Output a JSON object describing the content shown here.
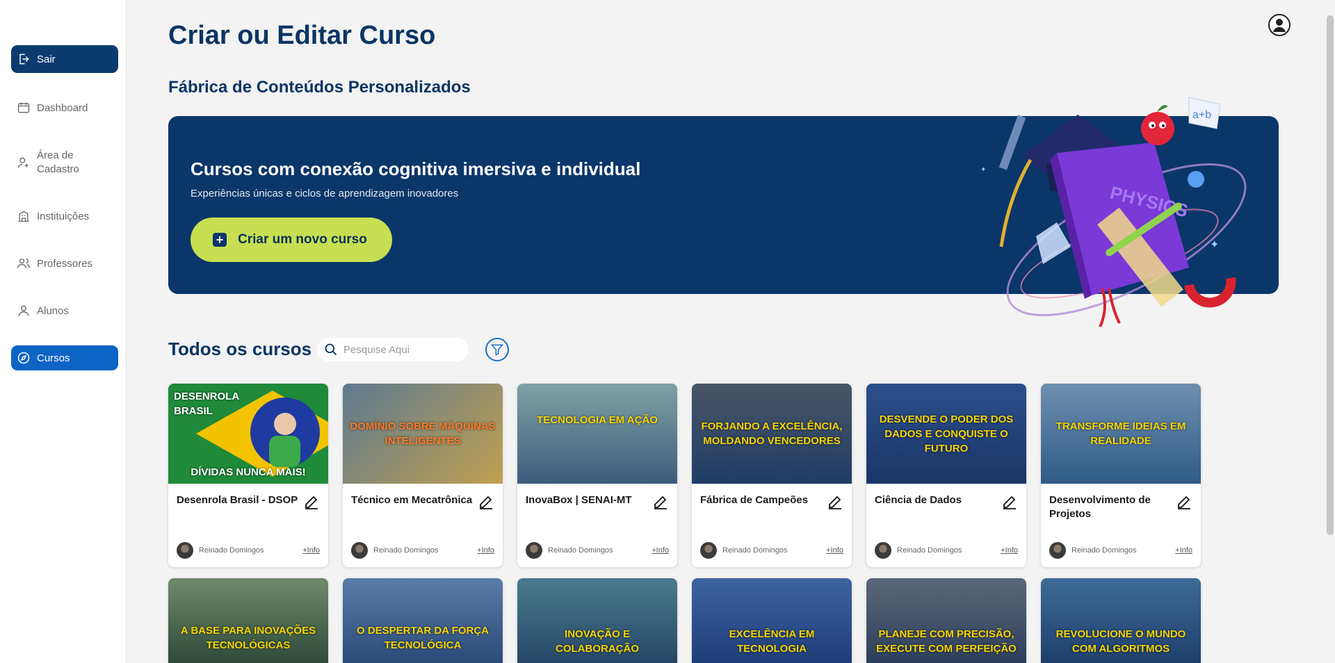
{
  "sidebar": {
    "items": [
      {
        "label": "Sair",
        "icon": "logout-icon"
      },
      {
        "label": "Dashboard",
        "icon": "calendar-icon"
      },
      {
        "label": "Área de Cadastro",
        "icon": "user-add-icon"
      },
      {
        "label": "Instituições",
        "icon": "building-icon"
      },
      {
        "label": "Professores",
        "icon": "users-icon"
      },
      {
        "label": "Alunos",
        "icon": "user-icon"
      },
      {
        "label": "Cursos",
        "icon": "compass-icon"
      }
    ]
  },
  "header": {
    "title": "Criar ou Editar Curso",
    "subtitle": "Fábrica de Conteúdos Personalizados",
    "profile_icon": "profile-icon"
  },
  "banner": {
    "title": "Cursos com conexão cognitiva imersiva e individual",
    "subtitle": "Experiências únicas e ciclos de aprendizagem inovadores",
    "cta_label": "Criar um novo curso",
    "book_word": "PHYSICS",
    "note_text": "a+b"
  },
  "courses_section": {
    "title": "Todos os cursos",
    "search_placeholder": "Pesquise Aqui",
    "filter_icon": "filter-icon"
  },
  "courses": [
    {
      "thumb_lines": [
        "DESENROLA",
        "BRASIL",
        "DÍVIDAS NUNCA MAIS!"
      ],
      "title": "Desenrola Brasil - DSOP",
      "author": "Reinado Domingos",
      "info": "+Info",
      "color": "#1f8a3a"
    },
    {
      "thumb_lines": [
        "DOMÍNIO SOBRE MÁQUINAS INTELIGENTES"
      ],
      "title": "Técnico em Mecatrônica",
      "author": "Reinado Domingos",
      "info": "+Info",
      "color": "#3f6e8c"
    },
    {
      "thumb_lines": [
        "TECNOLOGIA EM AÇÃO"
      ],
      "title": "InovaBox | SENAI-MT",
      "author": "Reinado Domingos",
      "info": "+Info",
      "color": "#4c6d8f"
    },
    {
      "thumb_lines": [
        "FORJANDO A EXCELÊNCIA, MOLDANDO VENCEDORES"
      ],
      "title": "Fábrica de Campeões",
      "author": "Reinado Domingos",
      "info": "+Info",
      "color": "#2f4e6e"
    },
    {
      "thumb_lines": [
        "DESVENDE O PODER DOS DADOS E CONQUISTE O FUTURO"
      ],
      "title": "Ciência de Dados",
      "author": "Reinado Domingos",
      "info": "+Info",
      "color": "#284d83"
    },
    {
      "thumb_lines": [
        "TRANSFORME IDEIAS EM REALIDADE"
      ],
      "title": "Desenvolvimento de Projetos",
      "author": "Reinado Domingos",
      "info": "+Info",
      "color": "#3b6a93"
    }
  ],
  "courses_row2": [
    {
      "thumb_lines": [
        "A BASE PARA INOVAÇÕES TECNOLÓGICAS"
      ],
      "color": "#466a4a"
    },
    {
      "thumb_lines": [
        "O DESPERTAR DA FORÇA TECNOLÓGICA"
      ],
      "color": "#3b5f86"
    },
    {
      "thumb_lines": [
        "INOVAÇÃO E COLABORAÇÃO"
      ],
      "color": "#36607c"
    },
    {
      "thumb_lines": [
        "EXCELÊNCIA EM TECNOLOGIA"
      ],
      "color": "#2a4d85"
    },
    {
      "thumb_lines": [
        "PLANEJE COM PRECISÃO, EXECUTE COM PERFEIÇÃO"
      ],
      "color": "#3c4f6d"
    },
    {
      "thumb_lines": [
        "REVOLUCIONE O MUNDO COM ALGORITMOS"
      ],
      "color": "#2f557f"
    }
  ],
  "colors": {
    "primary": "#0a3669",
    "active_nav": "#0e64c4",
    "accent": "#c8df52",
    "thumb_text": "#f5d300"
  }
}
